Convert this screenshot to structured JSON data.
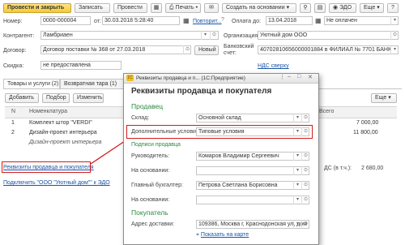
{
  "toolbar": {
    "post_close": "Провести и закрыть",
    "save": "Записать",
    "post": "Провести",
    "print": "Печать",
    "create_basis": "Создать на основании",
    "edo": "ЭДО",
    "more": "Еще",
    "help": "?"
  },
  "header": {
    "number_label": "Номер:",
    "number_value": "0000-000004",
    "from_label": "от:",
    "date_value": "30.03.2018  5:28:40",
    "repeat_link": "Повторит...",
    "payment_label": "Оплата до:",
    "payment_date": "13.04.2018",
    "payment_status": "Не оплачен",
    "counterparty_label": "Контрагент:",
    "counterparty_value": "Ламбриаен",
    "organization_label": "Организация:",
    "organization_value": "Уютный дом ООО",
    "contract_label": "Договор:",
    "contract_value": "Договор поставки № 368 от 27.03.2018",
    "new_button": "Новый",
    "bank_label": "Банковский счет:",
    "bank_value": "40702810656000001884 в ФИЛИАЛ № 7701 БАНК",
    "discount_label": "Скидка:",
    "discount_value": "не предоставлена",
    "vat_link": "НДС сверху"
  },
  "tabs": [
    {
      "label": "Товары и услуги (2)"
    },
    {
      "label": "Возвратная тара (1)"
    }
  ],
  "table_toolbar": {
    "add": "Добавить",
    "select": "Подбор",
    "change": "Изменить",
    "more": "Еще"
  },
  "table": {
    "col_n": "N",
    "col_name": "Номенклатура",
    "col_total": "Всего",
    "rows": [
      {
        "n": "1",
        "name": "Комплект штор \"VERDI\"",
        "total": "7 000,00"
      },
      {
        "n": "2",
        "name": "Дизайн-проект интерьера",
        "total": "11 800,00"
      },
      {
        "n": "",
        "name": "Дизайн-проект интерьера",
        "total": ""
      }
    ]
  },
  "footer": {
    "requisites_link": "Реквизиты продавца и покупателя",
    "connect_link": "Подключить \"ООО \"Уютный дом\"\" к ЭДО",
    "vat_label": "ДС (в т.ч.):",
    "vat_value": "2 680,00"
  },
  "popup": {
    "window_title": "Реквизиты продавца и п...   (1С:Предприятие)",
    "heading": "Реквизиты продавца и покупателя",
    "seller_section": "Продавец",
    "warehouse_label": "Склад:",
    "warehouse_value": "Основной склад",
    "conditions_label": "Дополнительные условия:",
    "conditions_value": "Типовые условия",
    "signatures_section": "Подписи продавца",
    "head_label": "Руководитель:",
    "head_value": "Комаров Владимир Сергеевич",
    "basis_label_1": "На основании:",
    "chief_acc_label": "Главный бухгалтер:",
    "chief_acc_value": "Петрова Светлана Борисовна",
    "basis_label_2": "На основании:",
    "buyer_section": "Покупатель",
    "address_label": "Адрес доставки:",
    "address_value": "109386, Москва г, Краснодонская ул, дом",
    "map_link": "Показать на карте"
  },
  "colors": {
    "accent_red": "#d41a1a",
    "section_green": "#2b8a3e",
    "link_blue": "#1a55a8",
    "primary_button": "#f5c933"
  }
}
